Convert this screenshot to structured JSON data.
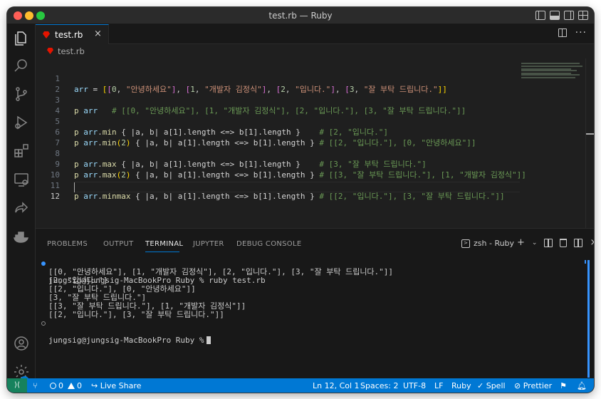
{
  "window": {
    "title": "test.rb — Ruby"
  },
  "tab": {
    "label": "test.rb",
    "close": "×"
  },
  "breadcrumb": {
    "file": "test.rb"
  },
  "editor": {
    "line_numbers": [
      "1",
      "2",
      "3",
      "4",
      "5",
      "6",
      "7",
      "8",
      "9",
      "10",
      "11",
      "12"
    ],
    "code": {
      "l1": {
        "var": "arr",
        "op": " = ",
        "b1": "[",
        "b2": "[",
        "n0": "0",
        "s0": "\"안녕하세요\"",
        "n1": "1",
        "s1": "\"개발자 김정식\"",
        "n2": "2",
        "s2": "\"입니다.\"",
        "n3": "3",
        "s3": "\"잘 부탁 드립니다.\"",
        "end": "]]"
      },
      "l3": {
        "fn": "p",
        "var": "arr",
        "cm": "# [[0, \"안녕하세요\"], [1, \"개발자 김정식\"], [2, \"입니다.\"], [3, \"잘 부탁 드립니다.\"]]"
      },
      "l5": {
        "fn": "p",
        "var": "arr",
        "method": "min",
        "body": "{ |a, b| a[1].length <=> b[1].length }",
        "cm": "# [2, \"입니다.\"]"
      },
      "l6": {
        "fn": "p",
        "var": "arr",
        "method": "min",
        "arg": "2",
        "body": "{ |a, b| a[1].length <=> b[1].length }",
        "cm": "# [[2, \"입니다.\"], [0, \"안녕하세요\"]]"
      },
      "l8": {
        "fn": "p",
        "var": "arr",
        "method": "max",
        "body": "{ |a, b| a[1].length <=> b[1].length }",
        "cm": "# [3, \"잘 부탁 드립니다.\"]"
      },
      "l9": {
        "fn": "p",
        "var": "arr",
        "method": "max",
        "arg": "2",
        "body": "{ |a, b| a[1].length <=> b[1].length }",
        "cm": "# [[3, \"잘 부탁 드립니다.\"], [1, \"개발자 김정식\"]]"
      },
      "l11": {
        "fn": "p",
        "var": "arr",
        "method": "minmax",
        "body": "{ |a, b| a[1].length <=> b[1].length }",
        "cm": "# [[2, \"입니다.\"], [3, \"잘 부탁 드립니다.\"]]"
      }
    }
  },
  "panel": {
    "tabs": [
      "PROBLEMS",
      "OUTPUT",
      "TERMINAL",
      "JUPYTER",
      "DEBUG CONSOLE"
    ],
    "active_tab": "TERMINAL",
    "shell": "zsh - Ruby",
    "add": "+",
    "close": "×"
  },
  "terminal": {
    "command_line": "jungsig@jungsig-MacBookPro Ruby % ruby test.rb",
    "output": [
      "[[0, \"안녕하세요\"], [1, \"개발자 김정식\"], [2, \"입니다.\"], [3, \"잘 부탁 드립니다.\"]]",
      "[2, \"입니다.\"]",
      "[[2, \"입니다.\"], [0, \"안녕하세요\"]]",
      "[3, \"잘 부탁 드립니다.\"]",
      "[[3, \"잘 부탁 드립니다.\"], [1, \"개발자 김정식\"]]",
      "[[2, \"입니다.\"], [3, \"잘 부탁 드립니다.\"]]"
    ],
    "prompt": "jungsig@jungsig-MacBookPro Ruby %"
  },
  "statusbar": {
    "errors": "0",
    "warnings": "0",
    "live_share": "Live Share",
    "position": "Ln 12, Col 1",
    "spaces": "Spaces: 2",
    "encoding": "UTF-8",
    "eol": "LF",
    "language": "Ruby",
    "spell": "Spell",
    "prettier": "Prettier"
  },
  "activity": {
    "settings_badge": "1"
  },
  "colors": {
    "accent": "#0078d4",
    "ruby_red": "#e51400",
    "remote_green": "#16825d"
  }
}
